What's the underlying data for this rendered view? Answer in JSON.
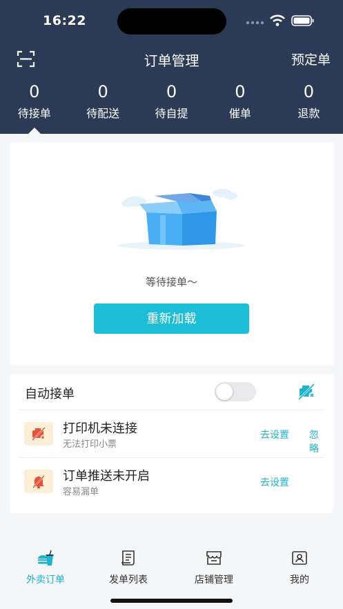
{
  "status_bar": {
    "time": "16:22"
  },
  "nav": {
    "title": "订单管理",
    "right_action": "预定单"
  },
  "stats": [
    {
      "count": "0",
      "label": "待接单",
      "active": true
    },
    {
      "count": "0",
      "label": "待配送"
    },
    {
      "count": "0",
      "label": "待自提"
    },
    {
      "count": "0",
      "label": "催单"
    },
    {
      "count": "0",
      "label": "退款"
    }
  ],
  "empty_state": {
    "text": "等待接单～",
    "reload_button": "重新加载"
  },
  "settings": {
    "auto_accept_label": "自动接单",
    "auto_accept_on": false,
    "notices": [
      {
        "title": "打印机未连接",
        "subtitle": "无法打印小票",
        "action": "去设置",
        "secondary_action": "忽略",
        "icon": "printer-off-icon"
      },
      {
        "title": "订单推送未开启",
        "subtitle": "容易漏单",
        "action": "去设置",
        "icon": "bell-off-icon"
      }
    ]
  },
  "tabs": [
    {
      "label": "外卖订单",
      "icon": "takeout-icon",
      "active": true
    },
    {
      "label": "发单列表",
      "icon": "list-icon"
    },
    {
      "label": "店铺管理",
      "icon": "store-icon"
    },
    {
      "label": "我的",
      "icon": "profile-icon"
    }
  ],
  "colors": {
    "header": "#2b3b55",
    "accent": "#1cbfd7",
    "warning_icon": "#e8503a",
    "warning_bg": "#fcefd8"
  }
}
